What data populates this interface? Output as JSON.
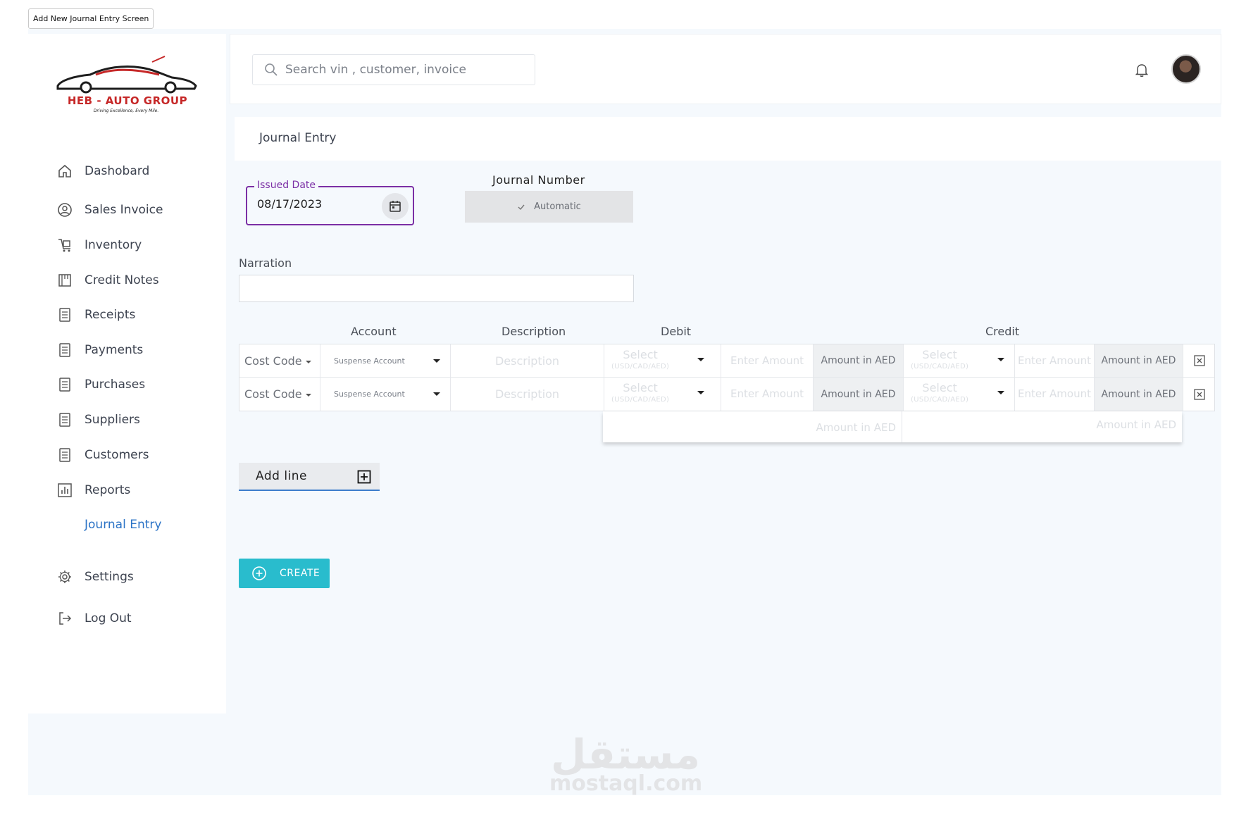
{
  "frame_label": "Add New Journal Entry Screen",
  "brand": {
    "name": "HEB - AUTO GROUP",
    "tagline": "Driving Excellence, Every Mile.",
    "accent": "#c62828"
  },
  "sidebar": {
    "items": [
      {
        "label": "Dashobard",
        "icon": "home-icon"
      },
      {
        "label": "Sales Invoice",
        "icon": "user-circle-icon"
      },
      {
        "label": "Inventory",
        "icon": "inventory-icon"
      },
      {
        "label": "Credit Notes",
        "icon": "notes-icon"
      },
      {
        "label": "Receipts",
        "icon": "document-icon"
      },
      {
        "label": "Payments",
        "icon": "document-icon"
      },
      {
        "label": "Purchases",
        "icon": "document-icon"
      },
      {
        "label": "Suppliers",
        "icon": "document-icon"
      },
      {
        "label": "Customers",
        "icon": "document-icon"
      },
      {
        "label": "Reports",
        "icon": "chart-icon"
      },
      {
        "label": "Journal Entry",
        "icon": "",
        "active": true
      },
      {
        "label": "Settings",
        "icon": "gear-icon"
      },
      {
        "label": "Log Out",
        "icon": "logout-icon"
      }
    ],
    "active_color": "#2b73c6"
  },
  "topbar": {
    "search_placeholder": "Search vin , customer, invoice"
  },
  "page": {
    "title": "Journal Entry"
  },
  "form": {
    "issued_date_label": "Issued Date",
    "issued_date_value": "08/17/2023",
    "journal_number_label": "Journal Number",
    "journal_number_value": "Automatic",
    "narration_label": "Narration",
    "narration_value": ""
  },
  "lines": {
    "headers": {
      "account": "Account",
      "description": "Description",
      "debit": "Debit",
      "credit": "Credit"
    },
    "rows": [
      {
        "cost_code": "Cost Code",
        "account": "Suspense Account",
        "description": "Description",
        "debit_select": "Select",
        "debit_select_sub": "(USD/CAD/AED)",
        "debit_amount": "Enter Amount",
        "debit_aed": "Amount in AED",
        "credit_select": "Select",
        "credit_select_sub": "(USD/CAD/AED)",
        "credit_amount": "Enter Amount",
        "credit_aed": "Amount in AED"
      },
      {
        "cost_code": "Cost Code",
        "account": "Suspense Account",
        "description": "Description",
        "debit_select": "Select",
        "debit_select_sub": "(USD/CAD/AED)",
        "debit_amount": "Enter Amount",
        "debit_aed": "Amount in AED",
        "credit_select": "Select",
        "credit_select_sub": "(USD/CAD/AED)",
        "credit_amount": "Enter Amount",
        "credit_aed": "Amount in AED"
      }
    ],
    "totals": {
      "debit": "Amount in AED",
      "credit": "Amount in AED"
    }
  },
  "actions": {
    "add_line": "Add line",
    "create": "CREATE",
    "create_color": "#29bccd"
  },
  "watermark": {
    "arabic": "مستقل",
    "latin": "mostaql.com"
  }
}
